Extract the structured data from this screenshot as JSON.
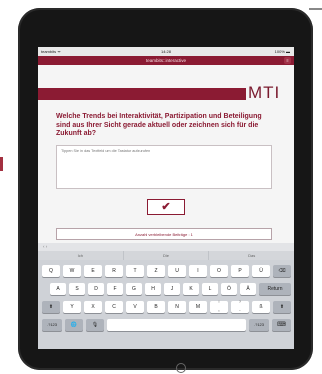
{
  "status_bar": {
    "carrier": "teambits ᯤ",
    "time": "14:28",
    "battery": "100% ▬"
  },
  "app": {
    "title": "teambits::interactive",
    "corner_icon": "menu-icon",
    "brand": "MTI",
    "accent": "#8b1b33"
  },
  "question": "Welche Trends bei Interaktivität, Partizipation und Beteiligung sind aus Ihrer Sicht gerade aktuell oder zeichnen sich für die Zukunft ab?",
  "answer": {
    "value": "",
    "placeholder": "Tippen Sie in das Textfeld um die Tastatur aufzurufen"
  },
  "submit_icon": "checkmark-icon",
  "remaining": "Anzahl verbleibende Beiträge : 1",
  "keyboard": {
    "nav": "‹ ›",
    "suggestions": [
      "Ich",
      "Die",
      "Das"
    ],
    "row1": [
      "Q",
      "W",
      "E",
      "R",
      "T",
      "Z",
      "U",
      "I",
      "O",
      "P",
      "Ü"
    ],
    "row1_end": "⌫",
    "row2": [
      "A",
      "S",
      "D",
      "F",
      "G",
      "H",
      "J",
      "K",
      "L",
      "Ö",
      "Ä"
    ],
    "row2_end": "Return",
    "row3_start": "⬆",
    "row3": [
      "Y",
      "X",
      "C",
      "V",
      "B",
      "N",
      "M"
    ],
    "row3_punct": [
      {
        "top": "!",
        "bottom": ","
      },
      {
        "top": "?",
        "bottom": "."
      }
    ],
    "row3_extra": "ß",
    "row3_end": "⬆",
    "row4": {
      "num_left": ".?123",
      "globe": "🌐",
      "mic": "🎙",
      "space": "",
      "num_right": ".?123",
      "hide": "⌨"
    }
  }
}
